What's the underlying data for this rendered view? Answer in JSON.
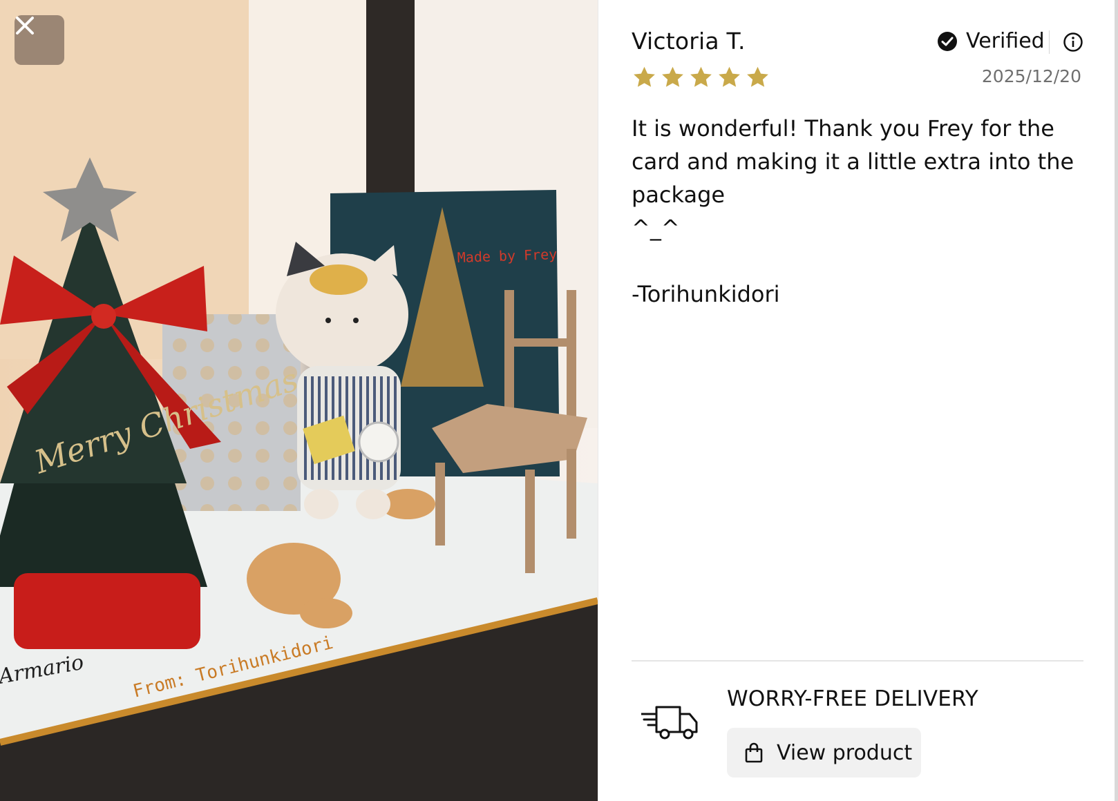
{
  "review": {
    "reviewer_name": "Victoria T.",
    "verified_label": "Verified",
    "rating": 5,
    "max_rating": 5,
    "date": "2025/12/20",
    "text": "It is wonderful! Thank you Frey for the card and making it a little extra into the package\n^_^\n\n-Torihunkidori"
  },
  "delivery": {
    "title": "WORRY-FREE DELIVERY",
    "view_product_label": "View product"
  },
  "photo": {
    "card_text": "Made by Frey",
    "ornament_text": "Merry Christmas",
    "mat_text": "From: Torihunkidori",
    "mat_text_2": "Armario"
  },
  "icons": {
    "close": "close-icon",
    "verified": "check-circle-icon",
    "info": "info-icon",
    "star": "star-icon",
    "truck": "delivery-truck-icon",
    "bag": "shopping-bag-icon"
  },
  "colors": {
    "star": "#c9a94a",
    "date": "#6f6f6f",
    "button_bg": "#f1f1f1"
  }
}
